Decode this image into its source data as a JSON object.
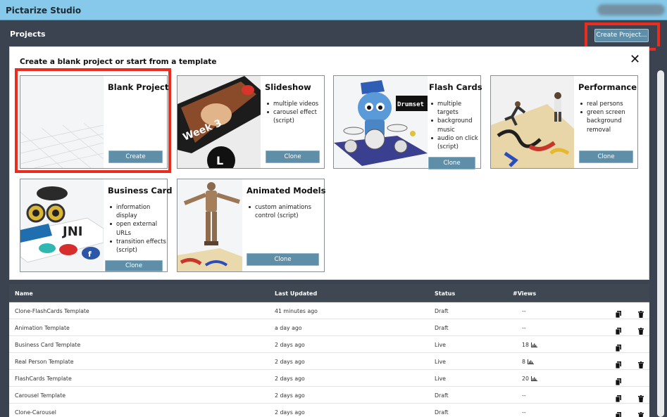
{
  "app": {
    "title": "Pictarize Studio"
  },
  "header": {
    "projects_label": "Projects",
    "create_button": "Create Project..."
  },
  "panel": {
    "title": "Create a blank project or start from a template",
    "close": "✕",
    "templates": [
      {
        "title": "Blank Project",
        "bullets": [],
        "button": "Create"
      },
      {
        "title": "Slideshow",
        "bullets": [
          "multiple videos",
          "carousel effect (script)"
        ],
        "button": "Clone",
        "thumb_text": "Week 3"
      },
      {
        "title": "Flash Cards",
        "bullets": [
          "multiple targets",
          "background music",
          "audio on click (script)"
        ],
        "button": "Clone",
        "thumb_text": "Drumset"
      },
      {
        "title": "Performance",
        "bullets": [
          "real persons",
          "green screen background removal"
        ],
        "button": "Clone"
      },
      {
        "title": "Business Card",
        "bullets": [
          "information display",
          "open external URLs",
          "transition effects (script)"
        ],
        "button": "Clone"
      },
      {
        "title": "Animated Models",
        "bullets": [
          "custom animations control (script)"
        ],
        "button": "Clone"
      }
    ]
  },
  "table": {
    "columns": [
      "Name",
      "Last Updated",
      "Status",
      "#Views"
    ],
    "rows": [
      {
        "name": "Clone-FlashCards Template",
        "updated": "41 minutes ago",
        "status": "Draft",
        "views": "--",
        "chart": false,
        "delete": true
      },
      {
        "name": "Animation Template",
        "updated": "a day ago",
        "status": "Draft",
        "views": "--",
        "chart": false,
        "delete": true
      },
      {
        "name": "Business Card Template",
        "updated": "2 days ago",
        "status": "Live",
        "views": "18",
        "chart": true,
        "delete": false
      },
      {
        "name": "Real Person Template",
        "updated": "2 days ago",
        "status": "Live",
        "views": "8",
        "chart": true,
        "delete": true
      },
      {
        "name": "FlashCards Template",
        "updated": "2 days ago",
        "status": "Live",
        "views": "20",
        "chart": true,
        "delete": false
      },
      {
        "name": "Carousel Template",
        "updated": "2 days ago",
        "status": "Draft",
        "views": "--",
        "chart": false,
        "delete": true
      },
      {
        "name": "Clone-Carousel",
        "updated": "2 days ago",
        "status": "Draft",
        "views": "--",
        "chart": false,
        "delete": true
      }
    ]
  },
  "colors": {
    "accent_button": "#5f8fa8",
    "highlight": "#ea2d1e",
    "titlebar": "#86c9ea",
    "background": "#3b4351"
  },
  "icons": {
    "copy": "copy-icon",
    "delete": "trash-icon",
    "views": "bar-chart-icon",
    "close": "close-icon"
  }
}
